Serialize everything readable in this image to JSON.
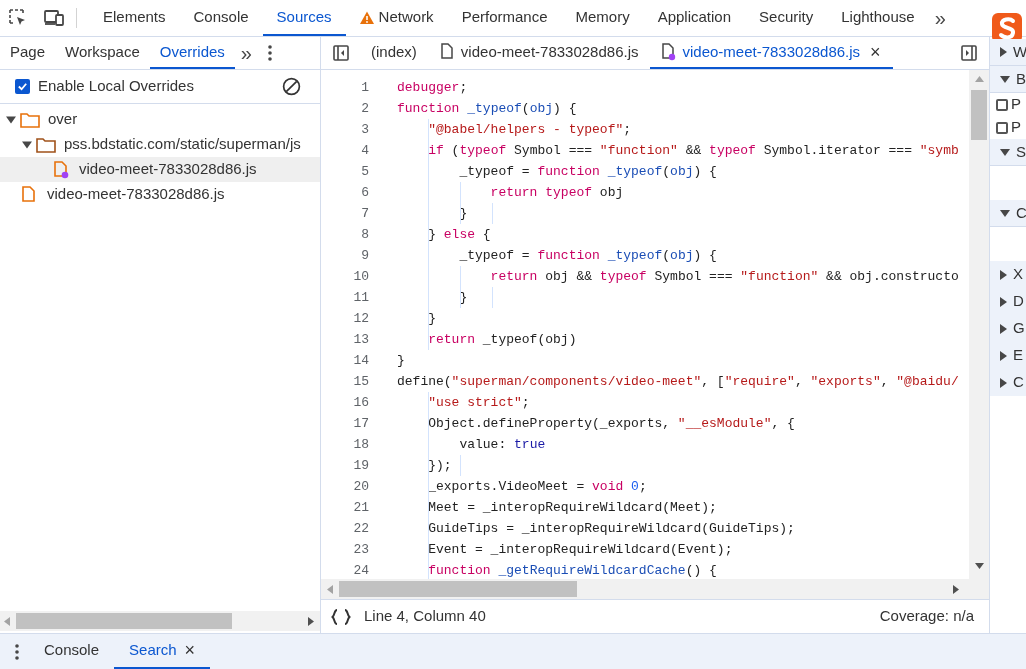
{
  "main_tabs": [
    {
      "label": "Elements",
      "selected": false,
      "warning": false
    },
    {
      "label": "Console",
      "selected": false,
      "warning": false
    },
    {
      "label": "Sources",
      "selected": true,
      "warning": false
    },
    {
      "label": "Network",
      "selected": false,
      "warning": true
    },
    {
      "label": "Performance",
      "selected": false,
      "warning": false
    },
    {
      "label": "Memory",
      "selected": false,
      "warning": false
    },
    {
      "label": "Application",
      "selected": false,
      "warning": false
    },
    {
      "label": "Security",
      "selected": false,
      "warning": false
    },
    {
      "label": "Lighthouse",
      "selected": false,
      "warning": false
    }
  ],
  "main_tabs_more": "»",
  "sidebar": {
    "tabs": [
      {
        "label": "Page",
        "selected": false
      },
      {
        "label": "Workspace",
        "selected": false
      },
      {
        "label": "Overrides",
        "selected": true
      }
    ],
    "more": "»",
    "enable_overrides": {
      "label": "Enable Local Overrides",
      "checked": true
    },
    "tree": [
      {
        "label": "over",
        "kind": "folder",
        "expanded": true,
        "selected": false,
        "children": [
          {
            "label": "pss.bdstatic.com/static/superman/js",
            "kind": "folder",
            "expanded": true,
            "selected": false,
            "children": [
              {
                "label": "video-meet-7833028d86.js",
                "kind": "file",
                "modified": true,
                "selected": true
              }
            ]
          }
        ]
      },
      {
        "label": "video-meet-7833028d86.js",
        "kind": "file",
        "modified": false,
        "selected": false
      }
    ]
  },
  "editor": {
    "tabs": [
      {
        "label": "(index)",
        "kind": "document",
        "selected": false,
        "modified": false,
        "closable": false
      },
      {
        "label": "video-meet-7833028d86.js",
        "kind": "file",
        "selected": false,
        "modified": false,
        "closable": false
      },
      {
        "label": "video-meet-7833028d86.js",
        "kind": "file",
        "selected": true,
        "modified": true,
        "closable": true
      }
    ],
    "close_mark": "×",
    "lines": [
      {
        "number": "1",
        "tokens": [
          {
            "kind": "keyword",
            "text": "debugger"
          },
          {
            "kind": "plain",
            "text": ";"
          }
        ]
      },
      {
        "number": "2",
        "tokens": [
          {
            "kind": "keyword",
            "text": "function"
          },
          {
            "kind": "def",
            "text": " _typeof"
          },
          {
            "kind": "plain",
            "text": "("
          },
          {
            "kind": "def",
            "text": "obj"
          },
          {
            "kind": "plain",
            "text": ") {"
          }
        ]
      },
      {
        "number": "3",
        "tokens": [
          {
            "kind": "string",
            "text": "    \"@babel/helpers - typeof\""
          },
          {
            "kind": "plain",
            "text": ";"
          }
        ]
      },
      {
        "number": "4",
        "tokens": [
          {
            "kind": "keyword",
            "text": "    if"
          },
          {
            "kind": "plain",
            "text": " ("
          },
          {
            "kind": "keyword",
            "text": "typeof"
          },
          {
            "kind": "plain",
            "text": " Symbol === "
          },
          {
            "kind": "string",
            "text": "\"function\""
          },
          {
            "kind": "plain",
            "text": " && "
          },
          {
            "kind": "keyword",
            "text": "typeof"
          },
          {
            "kind": "plain",
            "text": " Symbol.iterator === "
          },
          {
            "kind": "string",
            "text": "\"symb"
          }
        ]
      },
      {
        "number": "5",
        "tokens": [
          {
            "kind": "plain",
            "text": "        _typeof = "
          },
          {
            "kind": "keyword",
            "text": "function"
          },
          {
            "kind": "def",
            "text": " _typeof"
          },
          {
            "kind": "plain",
            "text": "("
          },
          {
            "kind": "def",
            "text": "obj"
          },
          {
            "kind": "plain",
            "text": ") {"
          }
        ]
      },
      {
        "number": "6",
        "tokens": [
          {
            "kind": "keyword",
            "text": "            return typeof"
          },
          {
            "kind": "plain",
            "text": " obj"
          }
        ]
      },
      {
        "number": "7",
        "tokens": [
          {
            "kind": "plain",
            "text": "        }"
          }
        ]
      },
      {
        "number": "8",
        "tokens": [
          {
            "kind": "plain",
            "text": "    } "
          },
          {
            "kind": "keyword",
            "text": "else"
          },
          {
            "kind": "plain",
            "text": " {"
          }
        ]
      },
      {
        "number": "9",
        "tokens": [
          {
            "kind": "plain",
            "text": "        _typeof = "
          },
          {
            "kind": "keyword",
            "text": "function"
          },
          {
            "kind": "def",
            "text": " _typeof"
          },
          {
            "kind": "plain",
            "text": "("
          },
          {
            "kind": "def",
            "text": "obj"
          },
          {
            "kind": "plain",
            "text": ") {"
          }
        ]
      },
      {
        "number": "10",
        "tokens": [
          {
            "kind": "keyword",
            "text": "            return"
          },
          {
            "kind": "plain",
            "text": " obj && "
          },
          {
            "kind": "keyword",
            "text": "typeof"
          },
          {
            "kind": "plain",
            "text": " Symbol === "
          },
          {
            "kind": "string",
            "text": "\"function\""
          },
          {
            "kind": "plain",
            "text": " && obj.constructo"
          }
        ]
      },
      {
        "number": "11",
        "tokens": [
          {
            "kind": "plain",
            "text": "        }"
          }
        ]
      },
      {
        "number": "12",
        "tokens": [
          {
            "kind": "plain",
            "text": "    }"
          }
        ]
      },
      {
        "number": "13",
        "tokens": [
          {
            "kind": "keyword",
            "text": "    return"
          },
          {
            "kind": "plain",
            "text": " _typeof(obj)"
          }
        ]
      },
      {
        "number": "14",
        "tokens": [
          {
            "kind": "plain",
            "text": "}"
          }
        ]
      },
      {
        "number": "15",
        "tokens": [
          {
            "kind": "plain",
            "text": "define("
          },
          {
            "kind": "string",
            "text": "\"superman/components/video-meet\""
          },
          {
            "kind": "plain",
            "text": ", ["
          },
          {
            "kind": "string",
            "text": "\"require\""
          },
          {
            "kind": "plain",
            "text": ", "
          },
          {
            "kind": "string",
            "text": "\"exports\""
          },
          {
            "kind": "plain",
            "text": ", "
          },
          {
            "kind": "string",
            "text": "\"@baidu/"
          }
        ]
      },
      {
        "number": "16",
        "tokens": [
          {
            "kind": "string",
            "text": "    \"use strict\""
          },
          {
            "kind": "plain",
            "text": ";"
          }
        ]
      },
      {
        "number": "17",
        "tokens": [
          {
            "kind": "plain",
            "text": "    Object.defineProperty(_exports, "
          },
          {
            "kind": "string",
            "text": "\"__esModule\""
          },
          {
            "kind": "plain",
            "text": ", {"
          }
        ]
      },
      {
        "number": "18",
        "tokens": [
          {
            "kind": "plain",
            "text": "        value: "
          },
          {
            "kind": "atom",
            "text": "true"
          }
        ]
      },
      {
        "number": "19",
        "tokens": [
          {
            "kind": "plain",
            "text": "    });"
          }
        ]
      },
      {
        "number": "20",
        "tokens": [
          {
            "kind": "plain",
            "text": "    _exports.VideoMeet = "
          },
          {
            "kind": "keyword",
            "text": "void"
          },
          {
            "kind": "number",
            "text": " 0"
          },
          {
            "kind": "plain",
            "text": ";"
          }
        ]
      },
      {
        "number": "21",
        "tokens": [
          {
            "kind": "plain",
            "text": "    Meet = _interopRequireWildcard(Meet);"
          }
        ]
      },
      {
        "number": "22",
        "tokens": [
          {
            "kind": "plain",
            "text": "    GuideTips = _interopRequireWildcard(GuideTips);"
          }
        ]
      },
      {
        "number": "23",
        "tokens": [
          {
            "kind": "plain",
            "text": "    Event = _interopRequireWildcard(Event);"
          }
        ]
      },
      {
        "number": "24",
        "tokens": [
          {
            "kind": "keyword",
            "text": "    function"
          },
          {
            "kind": "def",
            "text": " _getRequireWildcardCache"
          },
          {
            "kind": "plain",
            "text": "() {"
          }
        ]
      }
    ],
    "status": {
      "position": "Line 4, Column 40",
      "coverage": "Coverage: n/a"
    }
  },
  "right_panel": [
    {
      "kind": "header",
      "label": "W",
      "expanded": false
    },
    {
      "kind": "header",
      "label": "B",
      "expanded": true
    },
    {
      "kind": "checkbox",
      "label": "P",
      "checked": false
    },
    {
      "kind": "checkbox",
      "label": "P",
      "checked": false
    },
    {
      "kind": "header",
      "label": "S",
      "expanded": true
    },
    {
      "kind": "blank"
    },
    {
      "kind": "header",
      "label": "C",
      "expanded": true
    },
    {
      "kind": "blank"
    },
    {
      "kind": "section",
      "label": "X",
      "expanded": false
    },
    {
      "kind": "section",
      "label": "D",
      "expanded": false
    },
    {
      "kind": "section",
      "label": "G",
      "expanded": false
    },
    {
      "kind": "section",
      "label": "E",
      "expanded": false
    },
    {
      "kind": "section",
      "label": "C",
      "expanded": false
    }
  ],
  "drawer": {
    "tabs": [
      {
        "label": "Console",
        "selected": false,
        "closable": false
      },
      {
        "label": "Search",
        "selected": true,
        "closable": true
      }
    ],
    "close_mark": "×"
  }
}
